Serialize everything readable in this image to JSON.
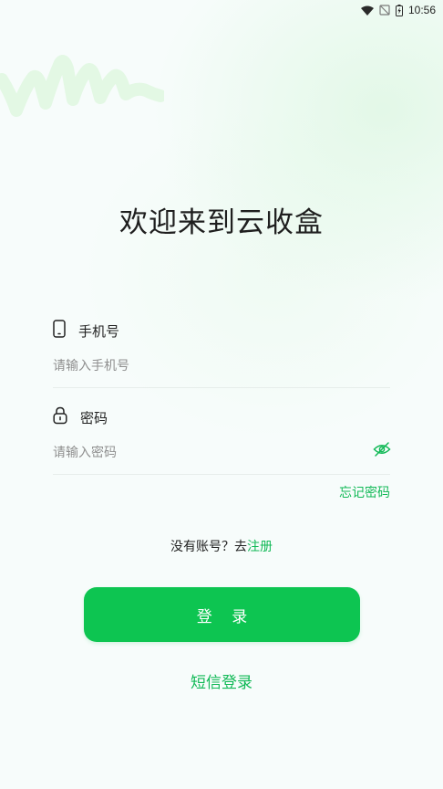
{
  "status_bar": {
    "time": "10:56",
    "icons": [
      "wifi-icon",
      "signal-off-icon",
      "battery-charging-icon"
    ]
  },
  "title": "欢迎来到云收盒",
  "phone_field": {
    "label": "手机号",
    "icon": "phone-icon",
    "placeholder": "请输入手机号",
    "value": ""
  },
  "password_field": {
    "label": "密码",
    "icon": "lock-icon",
    "placeholder": "请输入密码",
    "value": "",
    "toggle_icon": "eye-off-icon"
  },
  "forgot_password": "忘记密码",
  "register": {
    "prompt": "没有账号？去",
    "link": "注册"
  },
  "login_button": "登 录",
  "sms_login": "短信登录",
  "colors": {
    "accent": "#0dc551",
    "link": "#11b956",
    "background": "#f7fcfb"
  }
}
